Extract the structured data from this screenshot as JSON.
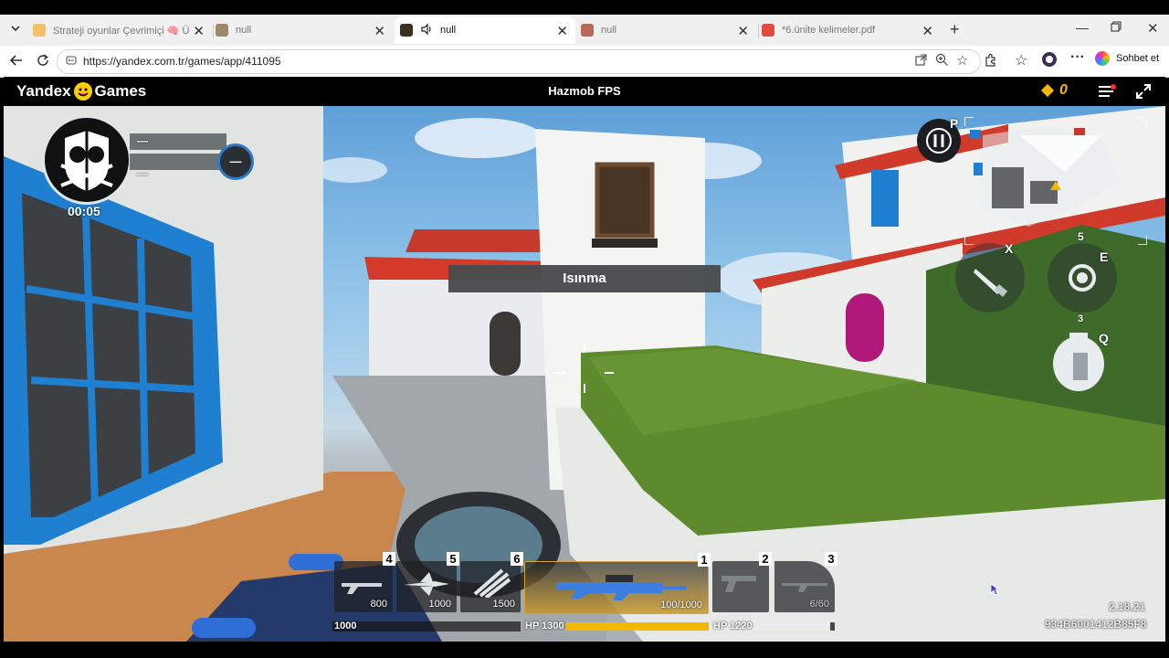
{
  "browser": {
    "tabs": [
      {
        "title": "Strateji oyunlar Çevrimiçi 🧠 Ücret"
      },
      {
        "title": "null"
      },
      {
        "title": "null"
      },
      {
        "title": "null"
      },
      {
        "title": "*6.ünite kelimeler.pdf"
      }
    ],
    "url": "https://yandex.com.tr/games/app/411095",
    "profile_label": "Sohbet et"
  },
  "yandex_bar": {
    "logo_left": "Yandex",
    "logo_right": "Games",
    "game_title": "Hazmob FPS",
    "coins": "0"
  },
  "game": {
    "timer": "00:05",
    "team_score_top": "—",
    "team_score_bottom": "—",
    "score_badge": "—",
    "banner": "Isınma",
    "key_pause": "P",
    "key_weapon_swap": "X",
    "key_equipment": "E",
    "equipment_count": "5",
    "key_grenade": "Q",
    "grenade_count": "3",
    "slots": [
      {
        "num": "4",
        "value": "800"
      },
      {
        "num": "5",
        "value": "1000"
      },
      {
        "num": "6",
        "value": "1500"
      },
      {
        "num": "1",
        "value": "100/1000"
      },
      {
        "num": "2",
        "value": ""
      },
      {
        "num": "3",
        "value": "6/60"
      }
    ],
    "bar_left_label": "1000",
    "hp1_label": "HP 1300",
    "hp1_fill": 1.0,
    "hp2_label": "HP 1220",
    "hp2_fill": 0.94,
    "version": "2.18.21",
    "session_id": "934B6001412B85F8"
  },
  "colors": {
    "accent_gold": "#f5b800",
    "window_blue": "#1f7fd0",
    "roof_red": "#d63a2a",
    "hedge_green": "#5d8a2c"
  }
}
